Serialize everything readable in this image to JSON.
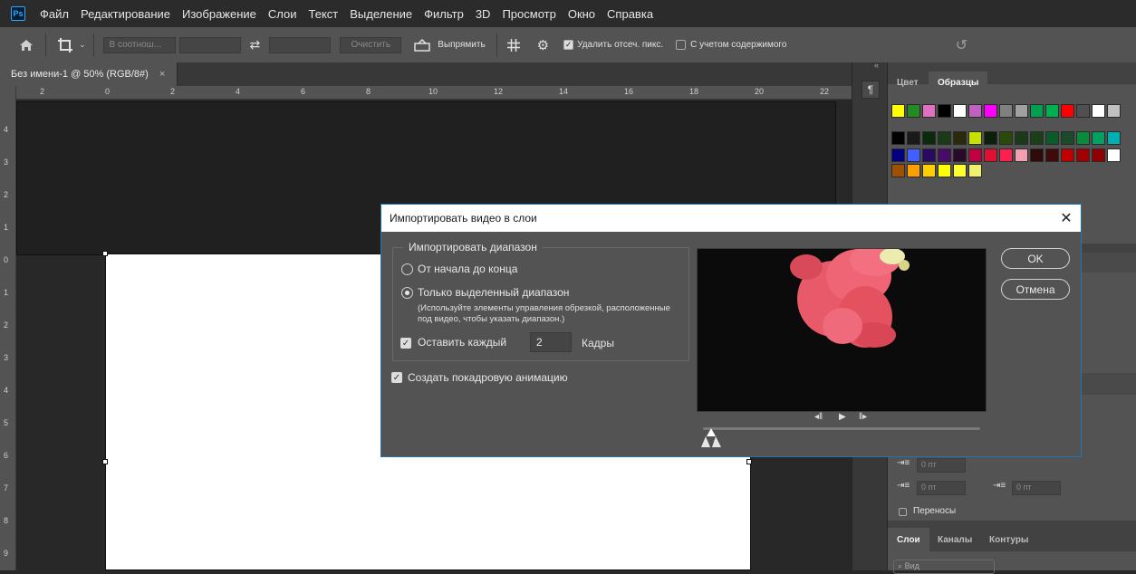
{
  "app": {
    "logo": "Ps"
  },
  "menu": [
    "Файл",
    "Редактирование",
    "Изображение",
    "Слои",
    "Текст",
    "Выделение",
    "Фильтр",
    "3D",
    "Просмотр",
    "Окно",
    "Справка"
  ],
  "options": {
    "ratio_select": "В соотнош...",
    "clear_button": "Очистить",
    "straighten_label": "Выпрямить",
    "delete_cropped_label": "Удалить отсеч. пикс.",
    "delete_cropped_checked": true,
    "content_aware_label": "С учетом содержимого",
    "content_aware_checked": false
  },
  "document_tab": {
    "title": "Без имени-1 @ 50% (RGB/8#)",
    "close": "×"
  },
  "ruler": {
    "h_ticks": [
      "2",
      "0",
      "2",
      "4",
      "6",
      "8",
      "10",
      "12",
      "14",
      "16",
      "18",
      "20",
      "22"
    ],
    "v_ticks": [
      "4",
      "3",
      "2",
      "1",
      "0",
      "1",
      "2",
      "3",
      "4",
      "5",
      "6",
      "7",
      "8",
      "9"
    ]
  },
  "panels": {
    "color_tab": "Цвет",
    "swatches_tab": "Образцы",
    "spacing_values": [
      "0 пт",
      "0 пт",
      "0 пт",
      "0 пт"
    ],
    "hyphenation_label": "Переносы",
    "layers_tabs": [
      "Слои",
      "Каналы",
      "Контуры"
    ],
    "search_placeholder": "Вид"
  },
  "swatch_colors": {
    "row1": [
      "#ffff00",
      "#228b22",
      "#e070c0",
      "#000000",
      "#ffffff",
      "#c060c0",
      "#ff00ff",
      "#808080",
      "#a0a0a0",
      "#00a050",
      "#00b050",
      "#ff0000",
      "#505050",
      "#ffffff",
      "#c0c0c0"
    ],
    "row2": [
      "#000000",
      "#1a1a1a",
      "#0a2a0a",
      "#1a3a1a",
      "#2a2a0a",
      "#c8e000",
      "#0a200a",
      "#2a4a0a",
      "#1a3a1a",
      "#1a401a",
      "#0a5a2a",
      "#1a4a2a",
      "#0a8a3a",
      "#00a060",
      "#00b0b0"
    ],
    "row3": [
      "#000080",
      "#4060ff",
      "#2a0a60",
      "#4a0a6a",
      "#2a0a2a",
      "#c00040",
      "#e01030",
      "#ff2050",
      "#f0a0b0",
      "#300a0a",
      "#400a0a",
      "#c00000",
      "#a00000",
      "#900000",
      "#ffffff"
    ],
    "row4": [
      "#a05000",
      "#ffa000",
      "#ffd000",
      "#ffff00",
      "#ffff30",
      "#f0f070"
    ]
  },
  "dialog": {
    "title": "Импортировать видео в слои",
    "close": "✕",
    "range_legend": "Импортировать диапазон",
    "option_all": "От начала до конца",
    "option_selected": "Только выделенный диапазон",
    "selected_checked": true,
    "hint": "(Используйте элементы управления обрезкой, расположенные под видео, чтобы указать диапазон.)",
    "keep_every_label": "Оставить каждый",
    "keep_every_checked": true,
    "keep_every_value": "2",
    "frames_label": "Кадры",
    "make_animation_label": "Создать покадровую анимацию",
    "make_animation_checked": true,
    "ok": "OK",
    "cancel": "Отмена",
    "controls": {
      "prev": "◂‖",
      "play": "▶",
      "next": "‖▸"
    },
    "scrub_position": 0.03
  }
}
